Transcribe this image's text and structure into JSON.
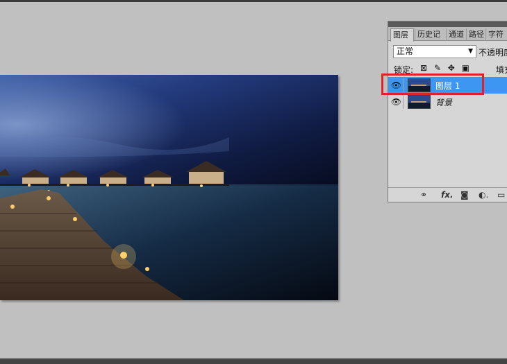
{
  "panel": {
    "tabs": [
      {
        "label": "图层",
        "active": true
      },
      {
        "label": "历史记"
      },
      {
        "label": "通道"
      },
      {
        "label": "路径"
      },
      {
        "label": "字符"
      }
    ],
    "blend_mode": "正常",
    "opacity_label": "不透明度",
    "lock_label": "锁定:",
    "fill_label": "填充",
    "layers": [
      {
        "name": "图层 1",
        "selected": true,
        "visible": true
      },
      {
        "name": "背景",
        "selected": false,
        "visible": true
      }
    ],
    "footer_icons": [
      "link-icon",
      "fx-icon",
      "mask-icon",
      "adjustment-icon",
      "group-icon"
    ],
    "footer_glyphs": {
      "link": "⚭",
      "fx": "fx.",
      "mask": "◙",
      "adjust": "◐.",
      "group": "▭"
    }
  },
  "colors": {
    "workspace": "#c0c0c0",
    "selection": "#3d97f2",
    "highlight_box": "#e0202a"
  },
  "icons": {
    "eye": "👁",
    "lock_glyphs": "⊠ ✎ ✥ ▣",
    "dropdown": "▼"
  }
}
